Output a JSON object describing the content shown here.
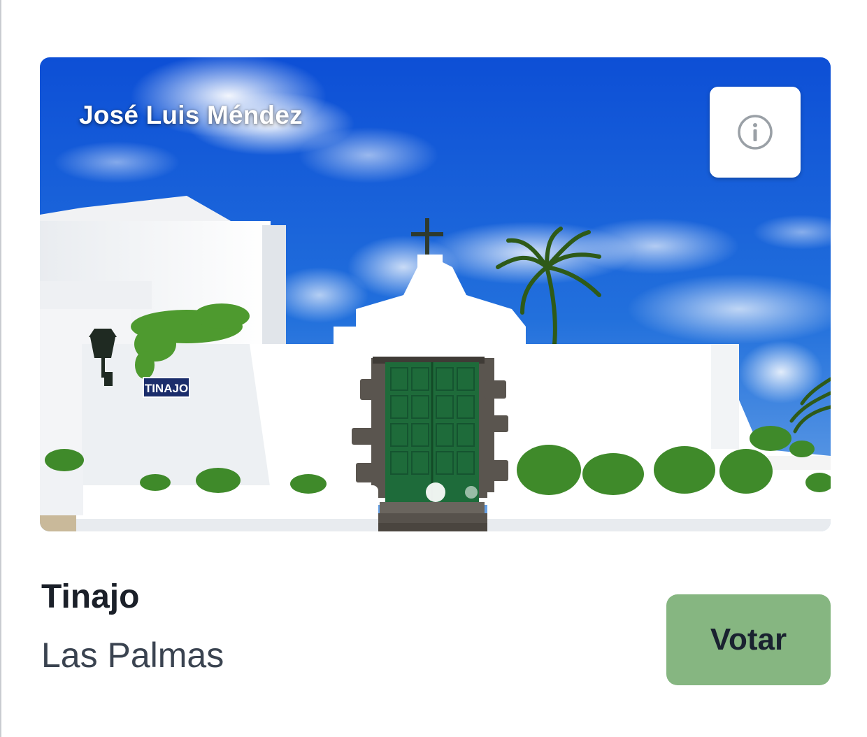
{
  "card": {
    "photo_credit": "José Luis Méndez",
    "photo_sign_text": "TINAJO",
    "info_icon": "info-circle-icon",
    "carousel": {
      "total": 2,
      "active_index": 0
    },
    "name": "Tinajo",
    "region": "Las Palmas",
    "vote_label": "Votar"
  },
  "colors": {
    "vote_button": "#86b681",
    "title_text": "#1b2029",
    "subtitle_text": "#3a4350",
    "sky": "#1b5fd0",
    "door": "#1e6b3a"
  }
}
